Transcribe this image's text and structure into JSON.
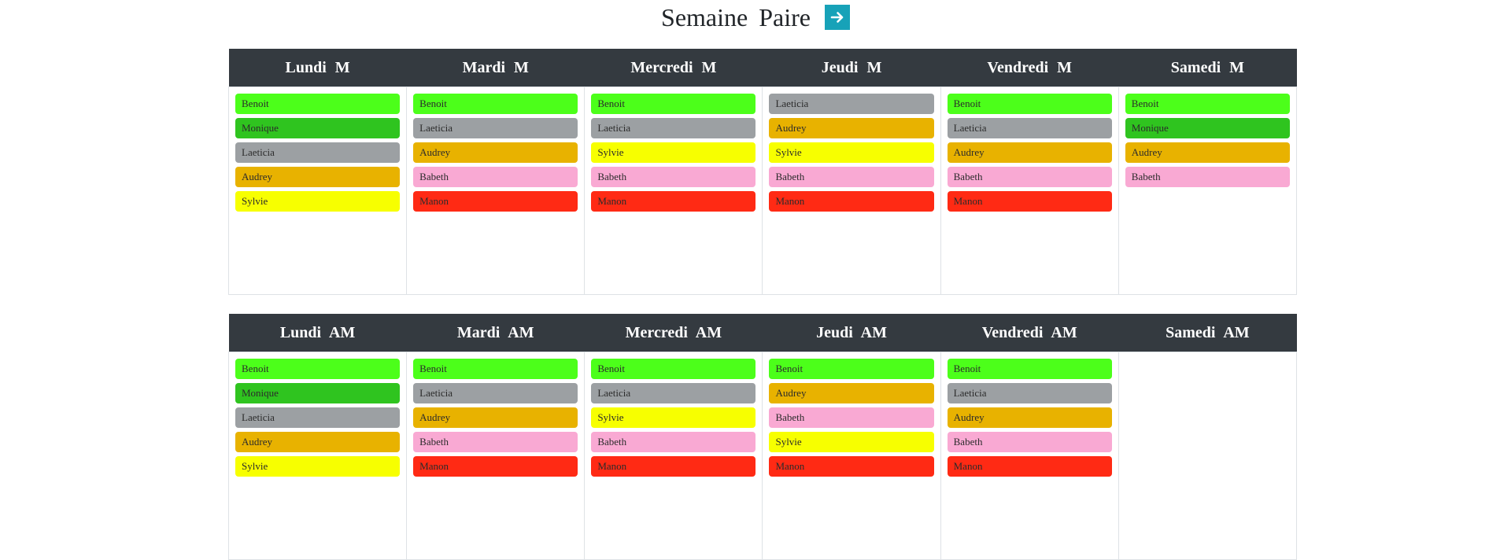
{
  "header": {
    "title": "Semaine Paire",
    "next_icon": "arrow-right-icon"
  },
  "colors": {
    "Benoit": "#4cff1a",
    "Monique": "#2fc41f",
    "Laeticia": "#9ca0a3",
    "Audrey": "#e8b200",
    "Sylvie": "#f7ff00",
    "Babeth": "#f9a9d3",
    "Manon": "#ff2a14"
  },
  "morning": {
    "days": [
      {
        "label": "Lundi  M",
        "people": [
          "Benoit",
          "Monique",
          "Laeticia",
          "Audrey",
          "Sylvie"
        ]
      },
      {
        "label": "Mardi  M",
        "people": [
          "Benoit",
          "Laeticia",
          "Audrey",
          "Babeth",
          "Manon"
        ]
      },
      {
        "label": "Mercredi  M",
        "people": [
          "Benoit",
          "Laeticia",
          "Sylvie",
          "Babeth",
          "Manon"
        ]
      },
      {
        "label": "Jeudi  M",
        "people": [
          "Laeticia",
          "Audrey",
          "Sylvie",
          "Babeth",
          "Manon"
        ]
      },
      {
        "label": "Vendredi  M",
        "people": [
          "Benoit",
          "Laeticia",
          "Audrey",
          "Babeth",
          "Manon"
        ]
      },
      {
        "label": "Samedi  M",
        "people": [
          "Benoit",
          "Monique",
          "Audrey",
          "Babeth"
        ]
      }
    ]
  },
  "afternoon": {
    "days": [
      {
        "label": "Lundi  AM",
        "people": [
          "Benoit",
          "Monique",
          "Laeticia",
          "Audrey",
          "Sylvie"
        ]
      },
      {
        "label": "Mardi  AM",
        "people": [
          "Benoit",
          "Laeticia",
          "Audrey",
          "Babeth",
          "Manon"
        ]
      },
      {
        "label": "Mercredi  AM",
        "people": [
          "Benoit",
          "Laeticia",
          "Sylvie",
          "Babeth",
          "Manon"
        ]
      },
      {
        "label": "Jeudi  AM",
        "people": [
          "Benoit",
          "Audrey",
          "Babeth",
          "Sylvie",
          "Manon"
        ]
      },
      {
        "label": "Vendredi  AM",
        "people": [
          "Benoit",
          "Laeticia",
          "Audrey",
          "Babeth",
          "Manon"
        ]
      },
      {
        "label": "Samedi  AM",
        "people": []
      }
    ]
  }
}
